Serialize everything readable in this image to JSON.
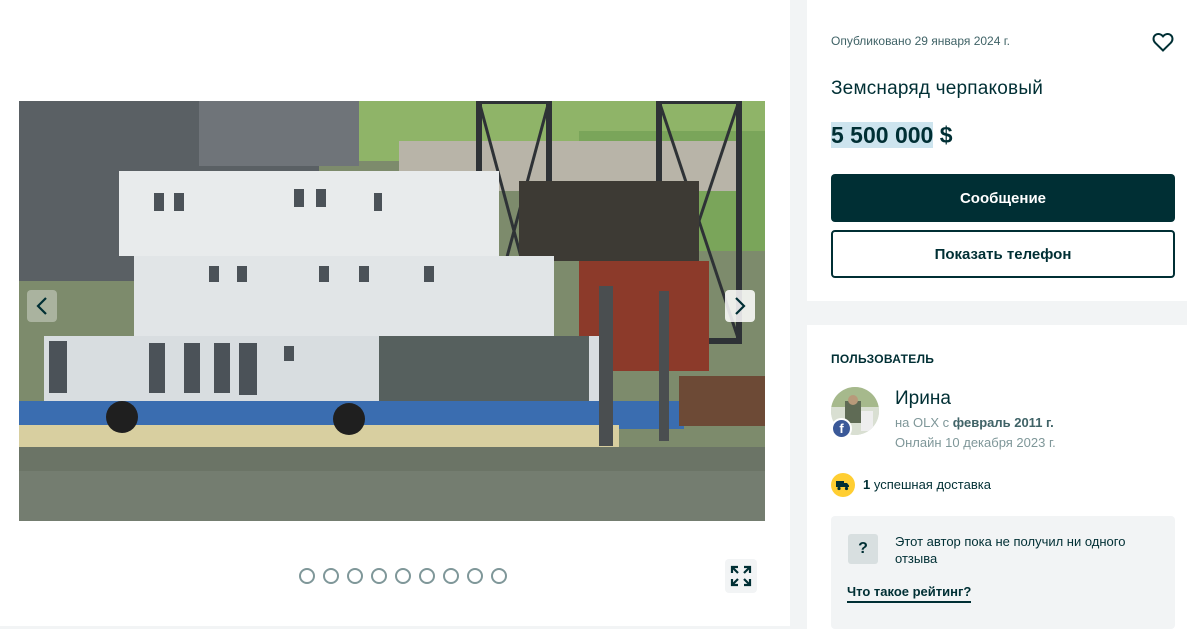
{
  "gallery": {
    "photo_alt": "",
    "dots_count": 9,
    "active_dot": 0
  },
  "ad": {
    "published": "Опубликовано 29 января 2024 г.",
    "title": "Земснаряд черпаковый",
    "price": "5 500 000",
    "currency": "$",
    "message_button": "Сообщение",
    "phone_button": "Показать телефон"
  },
  "user": {
    "heading": "ПОЛЬЗОВАТЕЛЬ",
    "name": "Ирина",
    "since_prefix": "на OLX с ",
    "since_date": "февраль 2011 г.",
    "online": "Онлайн 10 декабря 2023 г.",
    "delivery_count": "1",
    "delivery_label": " успешная доставка",
    "rating_text": "Этот автор пока не получил ни одного отзыва",
    "rating_link": "Что такое рейтинг?"
  },
  "icons": {
    "heart": "heart-icon",
    "prev": "chevron-left-icon",
    "next": "chevron-right-icon",
    "fullscreen": "expand-icon",
    "facebook": "facebook-icon",
    "delivery": "truck-icon",
    "question": "question-icon"
  },
  "colors": {
    "brand_dark": "#002f34",
    "price_highlight": "#cde4ee",
    "delivery_badge": "#ffce32",
    "facebook": "#3b5998"
  }
}
